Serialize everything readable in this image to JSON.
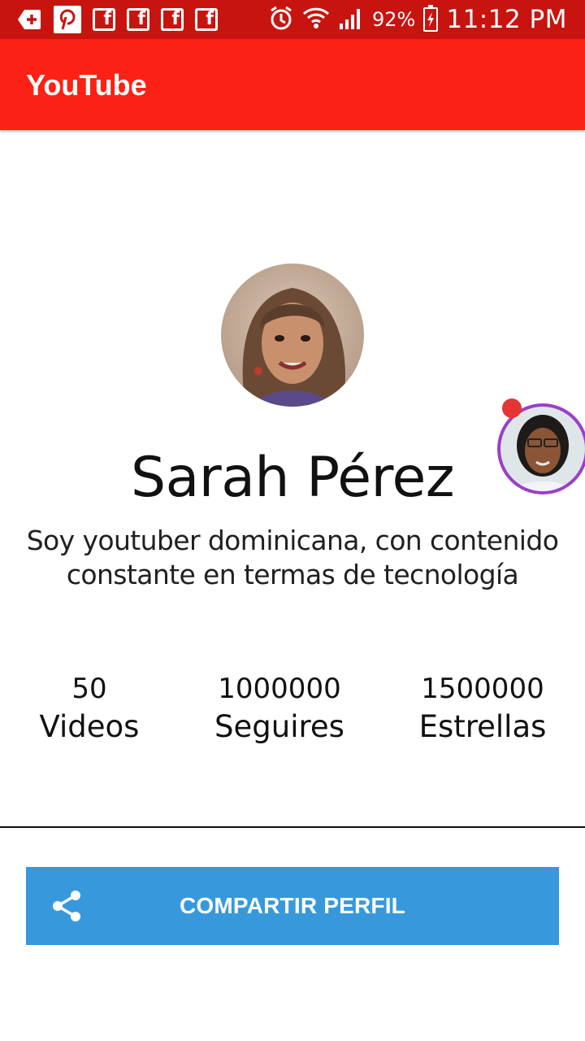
{
  "status_bar": {
    "battery_percent": "92%",
    "time": "11:12 PM",
    "notification_icons": [
      "add-box-icon",
      "pinterest-icon",
      "facebook-icon",
      "facebook-icon",
      "facebook-icon",
      "facebook-icon"
    ],
    "system_icons": [
      "alarm-icon",
      "wifi-icon",
      "signal-icon",
      "battery-charging-icon"
    ]
  },
  "app_bar": {
    "title": "YouTube",
    "color": "#fb2114"
  },
  "profile": {
    "name": "Sarah Pérez",
    "bio": "Soy youtuber dominicana, con contenido constante en termas de tecnología",
    "avatar_icon": "profile-photo"
  },
  "stats": [
    {
      "value": "50",
      "label": "Videos"
    },
    {
      "value": "1000000",
      "label": "Seguires"
    },
    {
      "value": "1500000",
      "label": "Estrellas"
    }
  ],
  "share_button": {
    "label": "COMPARTIR PERFIL",
    "icon": "share-icon",
    "color": "#3799dc"
  },
  "chat_head": {
    "icon": "messenger-chat-head"
  }
}
